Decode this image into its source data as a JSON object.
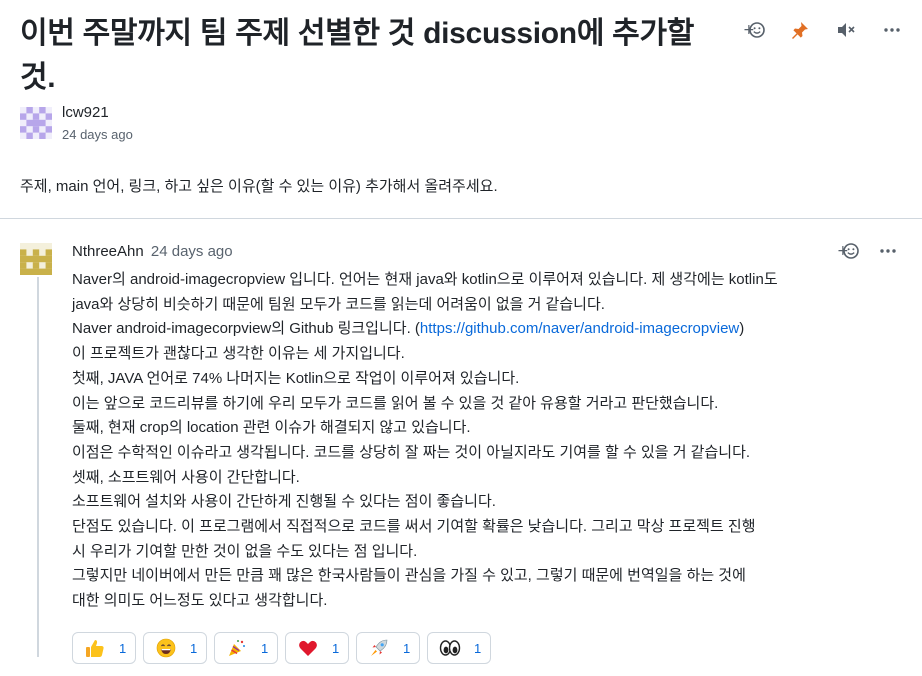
{
  "discussion": {
    "title_line1": "이번 주말까지 팀 주제 선별한 것 discussion에 추가할",
    "title_line2": "것.",
    "author": "lcw921",
    "time": "24 days ago",
    "body": "주제, main 언어, 링크, 하고 싶은 이유(할 수 있는 이유) 추가해서 올려주세요."
  },
  "comment": {
    "author": "NthreeAhn",
    "time": "24 days ago",
    "lines": [
      "Naver의 android-imagecropview 입니다. 언어는 현재 java와 kotlin으로 이루어져 있습니다. 제 생각에는 kotlin도",
      "java와 상당히 비슷하기 때문에 팀원 모두가 코드를 읽는데 어려움이 없을 거 같습니다.",
      "",
      "이 프로젝트가 괜찮다고 생각한 이유는 세 가지입니다.",
      "첫째, JAVA 언어로 74% 나머지는 Kotlin으로 작업이 이루어져 있습니다.",
      "이는 앞으로 코드리뷰를 하기에 우리 모두가 코드를 읽어 볼 수 있을 것 같아 유용할 거라고 판단했습니다.",
      "둘째, 현재 crop의 location 관련 이슈가 해결되지 않고 있습니다.",
      "이점은 수학적인 이슈라고 생각됩니다. 코드를 상당히 잘 짜는 것이 아닐지라도 기여를 할 수 있을 거 같습니다.",
      "셋째, 소프트웨어 사용이 간단합니다.",
      "소프트웨어 설치와 사용이 간단하게 진행될 수 있다는 점이 좋습니다.",
      "단점도 있습니다. 이 프로그램에서 직접적으로 코드를 써서 기여할 확률은 낮습니다. 그리고 막상 프로젝트 진행",
      "시 우리가 기여할 만한 것이 없을 수도 있다는 점 입니다.",
      "그렇지만 네이버에서 만든 만큼 꽤 많은 한국사람들이 관심을 가질 수 있고, 그렇기 때문에 번역일을 하는 것에",
      "대한 의미도 어느정도 있다고 생각합니다."
    ],
    "link_prefix": "Naver android-imagecorpview의 Github 링크입니다. (",
    "link_text": "https://github.com/naver/android-imagecropview",
    "link_suffix": ")",
    "reactions": [
      {
        "icon": "thumbs-up-icon",
        "count": "1"
      },
      {
        "icon": "laugh-icon",
        "count": "1"
      },
      {
        "icon": "hooray-icon",
        "count": "1"
      },
      {
        "icon": "heart-icon",
        "count": "1"
      },
      {
        "icon": "rocket-icon",
        "count": "1"
      },
      {
        "icon": "eyes-icon",
        "count": "1"
      }
    ]
  },
  "colors": {
    "link": "#0969da",
    "pin": "#e16f24",
    "border": "#d0d7de",
    "muted": "#59636e"
  }
}
